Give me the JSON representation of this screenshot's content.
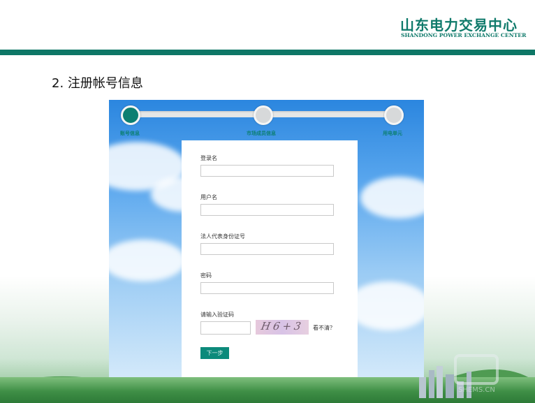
{
  "header": {
    "brand_cn": "山东电力交易中心",
    "brand_en": "SHANDONG POWER EXCHANGE CENTER",
    "accent_color": "#0e7766"
  },
  "section_title": "2. 注册帐号信息",
  "steps": [
    {
      "label": "账号信息",
      "active": true
    },
    {
      "label": "市场成员信息",
      "active": false
    },
    {
      "label": "用电单元",
      "active": false
    }
  ],
  "form": {
    "fields": [
      {
        "label": "登录名",
        "value": ""
      },
      {
        "label": "用户名",
        "value": ""
      },
      {
        "label": "法人代表身份证号",
        "value": ""
      },
      {
        "label": "密码",
        "value": ""
      }
    ],
    "captcha": {
      "label": "请输入验证码",
      "value": "",
      "image_text": "H6+3",
      "refresh_label": "看不清？"
    },
    "next_label": "下一步"
  },
  "watermark": "SHEMS.CN"
}
